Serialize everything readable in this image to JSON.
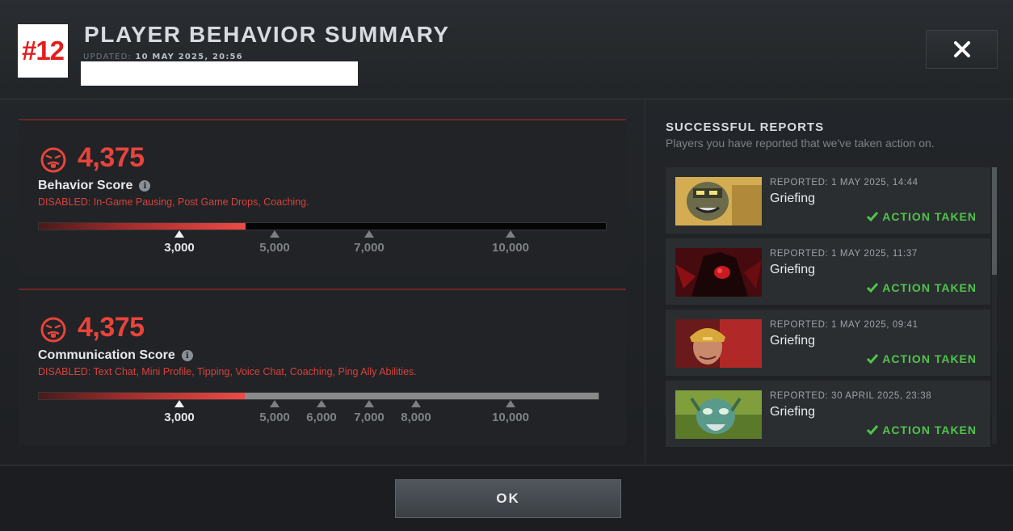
{
  "header": {
    "rank_badge": "#12",
    "title": "PLAYER BEHAVIOR SUMMARY",
    "updated_label": "UPDATED:",
    "updated_value": "10 MAY 2025, 20:56"
  },
  "behavior": {
    "value": "4,375",
    "label": "Behavior Score",
    "disabled": "DISABLED:  In-Game Pausing, Post Game Drops, Coaching.",
    "progress_fraction": 0.364,
    "ticks": [
      "3,000",
      "5,000",
      "7,000",
      "10,000"
    ]
  },
  "communication": {
    "value": "4,375",
    "label": "Communication Score",
    "disabled": "DISABLED:  Text Chat, Mini Profile, Tipping, Voice Chat, Coaching, Ping Ally Abilities.",
    "progress_fraction": 0.368,
    "ticks": [
      "3,000",
      "5,000",
      "6,000",
      "7,000",
      "8,000",
      "10,000"
    ]
  },
  "reports": {
    "title": "SUCCESSFUL REPORTS",
    "subtitle": "Players you have reported that we've taken action on.",
    "items": [
      {
        "meta": "REPORTED: 1 MAY 2025, 14:44",
        "reason": "Griefing",
        "status": "ACTION TAKEN",
        "hero_icon": "techies-portrait"
      },
      {
        "meta": "REPORTED: 1 MAY 2025, 11:37",
        "reason": "Griefing",
        "status": "ACTION TAKEN",
        "hero_icon": "shadow-demon-portrait"
      },
      {
        "meta": "REPORTED: 1 MAY 2025, 09:41",
        "reason": "Griefing",
        "status": "ACTION TAKEN",
        "hero_icon": "legion-commander-portrait"
      },
      {
        "meta": "REPORTED: 30 APRIL 2025, 23:38",
        "reason": "Griefing",
        "status": "ACTION TAKEN",
        "hero_icon": "tiny-portrait"
      }
    ]
  },
  "footer": {
    "ok_label": "OK"
  },
  "colors": {
    "accent_red": "#e8443c",
    "success_green": "#4fc54a",
    "badge_red": "#e31c1c"
  }
}
